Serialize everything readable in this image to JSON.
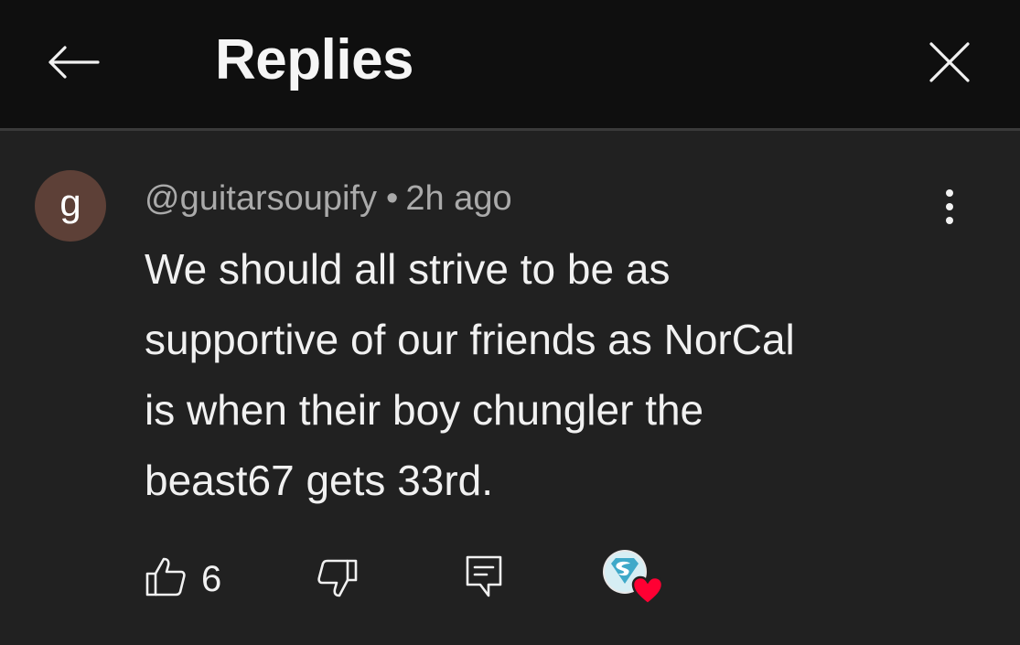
{
  "header": {
    "title": "Replies"
  },
  "comment": {
    "avatar_letter": "g",
    "avatar_color": "#5d4037",
    "username": "@guitarsoupify",
    "separator": "•",
    "timestamp": "2h ago",
    "body_lines": [
      "We should all strive to be as",
      "supportive of our friends as NorCal",
      "is when their boy chungler the",
      "beast67 gets 33rd."
    ],
    "like_count": "6",
    "creator_heart": true
  },
  "icons": {
    "back": "arrow-left-icon",
    "close": "close-icon",
    "more": "more-vertical-icon",
    "like": "thumbs-up-icon",
    "dislike": "thumbs-down-icon",
    "reply": "comment-reply-icon",
    "heart": "creator-heart-icon"
  },
  "colors": {
    "header_bg": "#0f0f0f",
    "body_bg": "#212121",
    "text_primary": "#f1f1f1",
    "text_secondary": "#aaaaaa",
    "heart": "#ff0033",
    "creator_avatar": "#3fa9c9"
  }
}
